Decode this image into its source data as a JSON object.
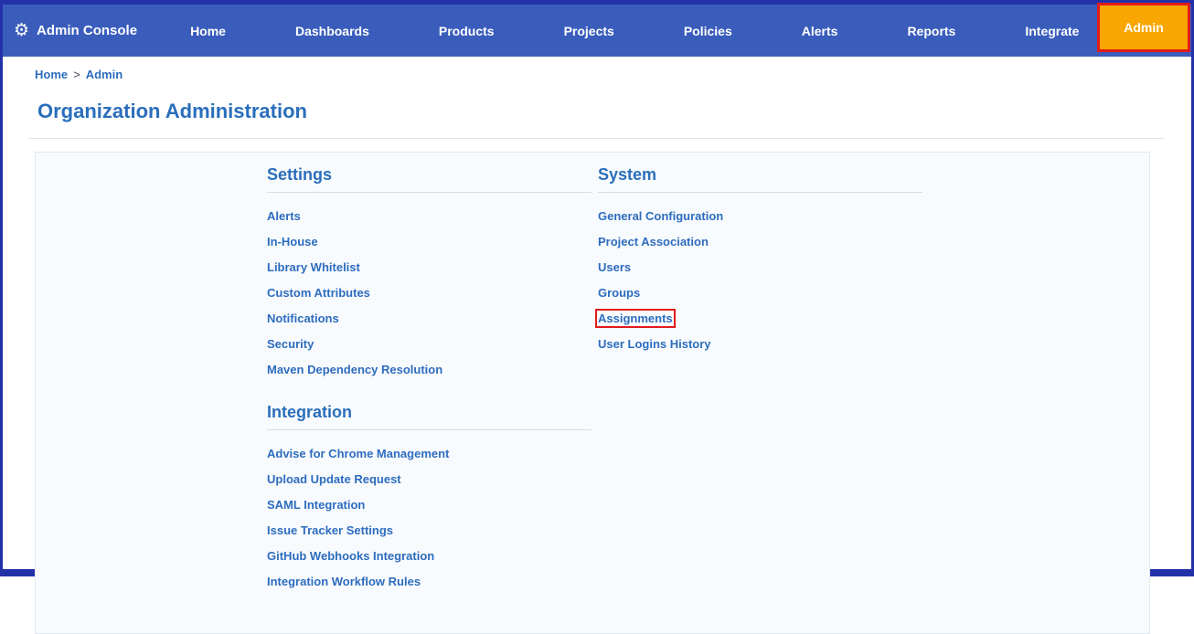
{
  "topbar": {
    "brand": "Admin Console",
    "items": [
      "Home",
      "Dashboards",
      "Products",
      "Projects",
      "Policies",
      "Alerts",
      "Reports",
      "Integrate"
    ],
    "admin_button": "Admin"
  },
  "breadcrumb": {
    "home": "Home",
    "separator": ">",
    "current": "Admin"
  },
  "page": {
    "title": "Organization Administration"
  },
  "sections": {
    "settings": {
      "title": "Settings",
      "links": [
        "Alerts",
        "In-House",
        "Library Whitelist",
        "Custom Attributes",
        "Notifications",
        "Security",
        "Maven Dependency Resolution"
      ]
    },
    "system": {
      "title": "System",
      "links": [
        "General Configuration",
        "Project Association",
        "Users",
        "Groups",
        "Assignments",
        "User Logins History"
      ]
    },
    "integration": {
      "title": "Integration",
      "links": [
        "Advise for Chrome Management",
        "Upload Update Request",
        "SAML Integration",
        "Issue Tracker Settings",
        "GitHub Webhooks Integration",
        "Integration Workflow Rules"
      ]
    }
  },
  "colors": {
    "navbar_blue": "#3a5dbc",
    "frame_dark_blue": "#2231a8",
    "accent_orange": "#f9a602",
    "link_blue": "#2d6cbe",
    "annotation_red": "#e01b1b"
  }
}
